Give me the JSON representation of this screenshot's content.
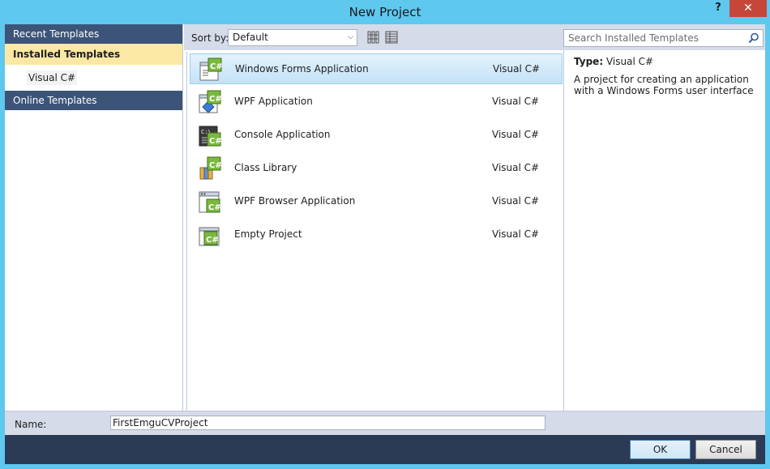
{
  "window": {
    "title": "New Project",
    "help_label": "?",
    "close_label": "✕"
  },
  "sidebar": {
    "recent_label": "Recent Templates",
    "installed_label": "Installed Templates",
    "sub_item": "Visual C#",
    "online_label": "Online Templates"
  },
  "toolbar": {
    "sort_label": "Sort by:",
    "sort_value": "Default",
    "search_placeholder": "Search Installed Templates"
  },
  "templates": [
    {
      "name": "Windows Forms Application",
      "lang": "Visual C#",
      "icon": "winforms-icon"
    },
    {
      "name": "WPF Application",
      "lang": "Visual C#",
      "icon": "wpf-icon"
    },
    {
      "name": "Console Application",
      "lang": "Visual C#",
      "icon": "console-icon"
    },
    {
      "name": "Class Library",
      "lang": "Visual C#",
      "icon": "class-library-icon"
    },
    {
      "name": "WPF Browser Application",
      "lang": "Visual C#",
      "icon": "wpf-browser-icon"
    },
    {
      "name": "Empty Project",
      "lang": "Visual C#",
      "icon": "empty-project-icon"
    }
  ],
  "details": {
    "type_label": "Type:",
    "type_value": "Visual C#",
    "description": "A project for creating an application with a Windows Forms user interface"
  },
  "name_row": {
    "label": "Name:",
    "value": "FirstEmguCVProject"
  },
  "buttons": {
    "ok": "OK",
    "cancel": "Cancel"
  },
  "colors": {
    "titlebar": "#5ec8ef",
    "sidebar_header": "#3c5478",
    "selected_installed": "#fbe8a4",
    "close": "#c7463a",
    "footer": "#2b3a55"
  }
}
